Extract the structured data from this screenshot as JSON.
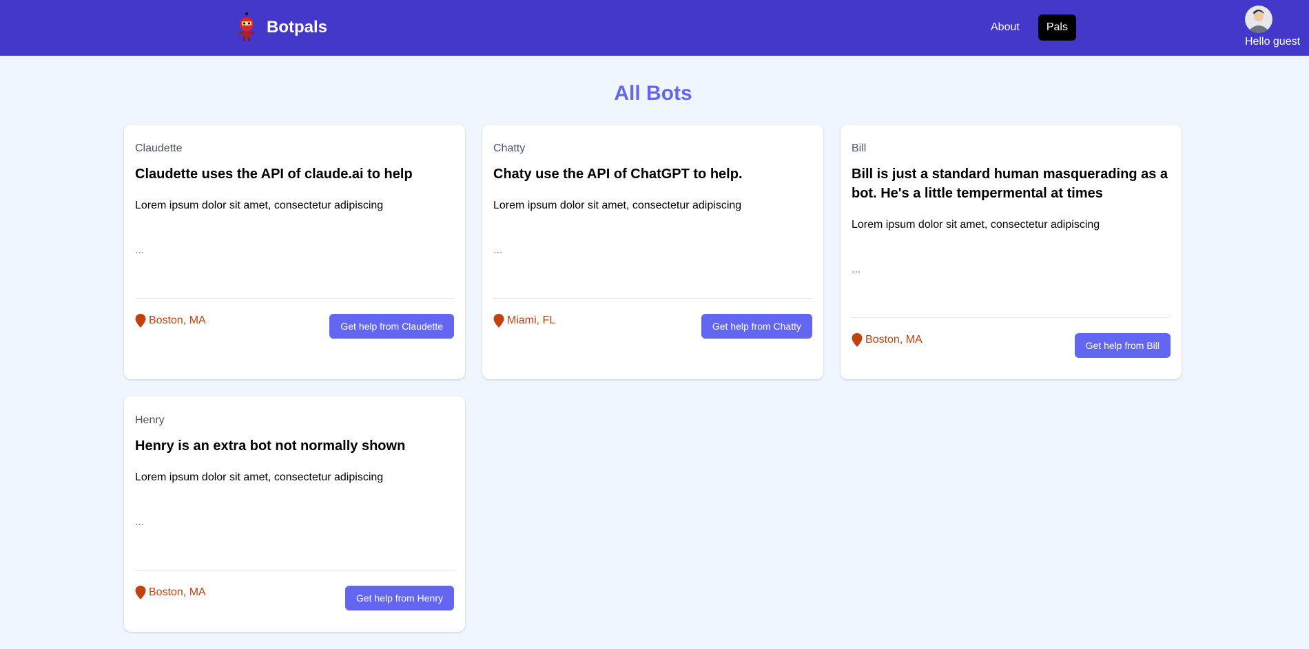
{
  "header": {
    "brand_name": "Botpals",
    "nav": [
      {
        "label": "About",
        "active": false
      },
      {
        "label": "Pals",
        "active": true
      }
    ],
    "greeting": "Hello guest"
  },
  "page": {
    "title": "All Bots"
  },
  "bots": [
    {
      "name": "Claudette",
      "title": "Claudette uses the API of claude.ai to help",
      "description": "Lorem ipsum dolor sit amet, consectetur adipiscing",
      "more": "...",
      "location": "Boston, MA",
      "button_label": "Get help from Claudette"
    },
    {
      "name": "Chatty",
      "title": "Chaty use the API of ChatGPT to help.",
      "description": "Lorem ipsum dolor sit amet, consectetur adipiscing",
      "more": "...",
      "location": "Miami, FL",
      "button_label": "Get help from Chatty"
    },
    {
      "name": "Bill",
      "title": "Bill is just a standard human masquerading as a bot. He's a little tempermental at times",
      "description": "Lorem ipsum dolor sit amet, consectetur adipiscing",
      "more": "...",
      "location": "Boston, MA",
      "button_label": "Get help from Bill"
    },
    {
      "name": "Henry",
      "title": "Henry is an extra bot not normally shown",
      "description": "Lorem ipsum dolor sit amet, consectetur adipiscing",
      "more": "...",
      "location": "Boston, MA",
      "button_label": "Get help from Henry"
    }
  ],
  "colors": {
    "header_bg": "#4338ca",
    "accent": "#6366f1",
    "location": "#c2410c",
    "page_bg": "#eff6ff"
  },
  "icons": {
    "brand": "robot-logo-icon",
    "location": "map-pin-icon",
    "avatar": "user-avatar"
  }
}
